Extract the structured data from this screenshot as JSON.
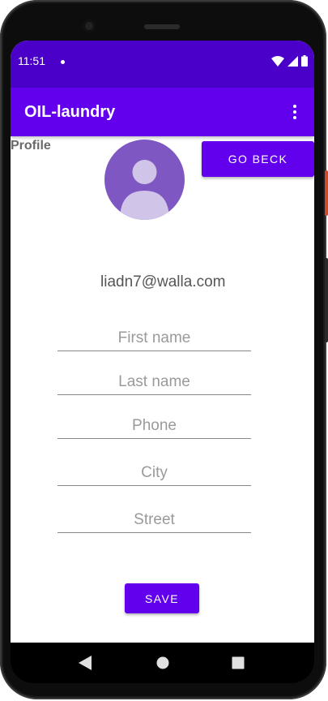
{
  "status_bar": {
    "time": "11:51",
    "icons": [
      "wifi-icon",
      "cellular-signal-icon",
      "battery-icon"
    ]
  },
  "app_bar": {
    "title": "OIL-laundry",
    "menu_icon": "more-vert-icon"
  },
  "profile": {
    "label": "Profile",
    "avatar_icon": "account-circle-icon",
    "go_back_label": "GO BECK",
    "email": "liadn7@walla.com"
  },
  "form": {
    "first_name": {
      "value": "",
      "placeholder": "First name"
    },
    "last_name": {
      "value": "",
      "placeholder": "Last name"
    },
    "phone": {
      "value": "",
      "placeholder": "Phone"
    },
    "city": {
      "value": "",
      "placeholder": "City"
    },
    "street": {
      "value": "",
      "placeholder": "Street"
    },
    "save_label": "SAVE"
  },
  "nav_bar": {
    "back_icon": "back-triangle-icon",
    "home_icon": "home-circle-icon",
    "recents_icon": "recents-square-icon"
  },
  "colors": {
    "status_bar": "#4a00c8",
    "primary": "#6200ee",
    "avatar_bg": "#7e57c2"
  }
}
